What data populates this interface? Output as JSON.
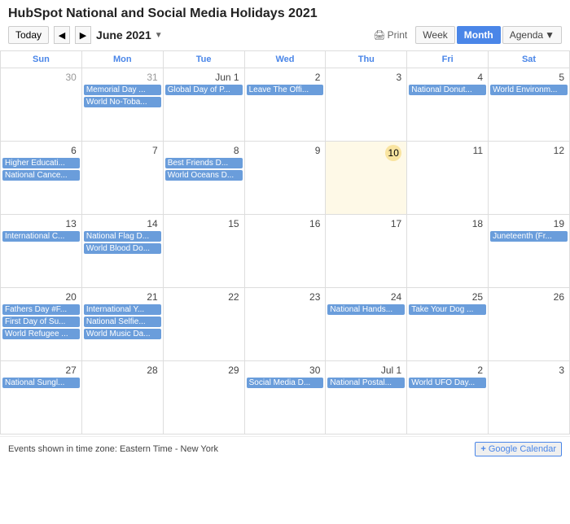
{
  "title": "HubSpot National and Social Media Holidays 2021",
  "toolbar": {
    "today_label": "Today",
    "month_label": "June 2021",
    "print_label": "Print",
    "week_label": "Week",
    "month_btn_label": "Month",
    "agenda_label": "Agenda"
  },
  "day_headers": [
    "Sun",
    "Mon",
    "Tue",
    "Wed",
    "Thu",
    "Fri",
    "Sat"
  ],
  "footer": {
    "timezone_text": "Events shown in time zone: Eastern Time - New York",
    "google_btn": "+ Google Calendar"
  },
  "weeks": [
    {
      "days": [
        {
          "num": "30",
          "other": true,
          "events": []
        },
        {
          "num": "31",
          "other": true,
          "events": [
            {
              "text": "Memorial Day ...",
              "cls": "event-blue"
            },
            {
              "text": "World No-Toba...",
              "cls": "event-blue"
            }
          ]
        },
        {
          "num": "Jun 1",
          "events": [
            {
              "text": "Global Day of P...",
              "cls": "event-blue"
            }
          ]
        },
        {
          "num": "2",
          "events": [
            {
              "text": "Leave The Offi...",
              "cls": "event-blue"
            }
          ]
        },
        {
          "num": "3",
          "events": []
        },
        {
          "num": "4",
          "events": [
            {
              "text": "National Donut...",
              "cls": "event-blue"
            }
          ]
        },
        {
          "num": "5",
          "events": [
            {
              "text": "World Environm...",
              "cls": "event-blue"
            }
          ]
        }
      ]
    },
    {
      "days": [
        {
          "num": "6",
          "events": [
            {
              "text": "Higher Educati...",
              "cls": "event-blue"
            },
            {
              "text": "National Cance...",
              "cls": "event-blue"
            }
          ]
        },
        {
          "num": "7",
          "events": []
        },
        {
          "num": "8",
          "events": [
            {
              "text": "Best Friends D...",
              "cls": "event-blue"
            },
            {
              "text": "World Oceans D...",
              "cls": "event-blue"
            }
          ]
        },
        {
          "num": "9",
          "events": []
        },
        {
          "num": "10",
          "today": true,
          "events": []
        },
        {
          "num": "11",
          "events": []
        },
        {
          "num": "12",
          "events": []
        }
      ]
    },
    {
      "days": [
        {
          "num": "13",
          "events": [
            {
              "text": "International C...",
              "cls": "event-blue"
            }
          ]
        },
        {
          "num": "14",
          "events": [
            {
              "text": "National Flag D...",
              "cls": "event-blue"
            },
            {
              "text": "World Blood Do...",
              "cls": "event-blue"
            }
          ]
        },
        {
          "num": "15",
          "events": []
        },
        {
          "num": "16",
          "events": []
        },
        {
          "num": "17",
          "events": []
        },
        {
          "num": "18",
          "events": []
        },
        {
          "num": "19",
          "events": [
            {
              "text": "Juneteenth (Fr...",
              "cls": "event-blue"
            }
          ]
        }
      ]
    },
    {
      "days": [
        {
          "num": "20",
          "events": [
            {
              "text": "Fathers Day #F...",
              "cls": "event-blue"
            },
            {
              "text": "First Day of Su...",
              "cls": "event-blue"
            },
            {
              "text": "World Refugee ...",
              "cls": "event-blue"
            }
          ]
        },
        {
          "num": "21",
          "events": [
            {
              "text": "International Y...",
              "cls": "event-blue"
            },
            {
              "text": "National Selfie...",
              "cls": "event-blue"
            },
            {
              "text": "World Music Da...",
              "cls": "event-blue"
            }
          ]
        },
        {
          "num": "22",
          "events": []
        },
        {
          "num": "23",
          "events": []
        },
        {
          "num": "24",
          "events": [
            {
              "text": "National Hands...",
              "cls": "event-blue"
            }
          ]
        },
        {
          "num": "25",
          "events": [
            {
              "text": "Take Your Dog ...",
              "cls": "event-blue"
            }
          ]
        },
        {
          "num": "26",
          "events": []
        }
      ]
    },
    {
      "days": [
        {
          "num": "27",
          "events": [
            {
              "text": "National Sungl...",
              "cls": "event-blue"
            }
          ]
        },
        {
          "num": "28",
          "events": []
        },
        {
          "num": "29",
          "events": []
        },
        {
          "num": "30",
          "events": [
            {
              "text": "Social Media D...",
              "cls": "event-blue"
            }
          ]
        },
        {
          "num": "Jul 1",
          "events": [
            {
              "text": "National Postal...",
              "cls": "event-blue"
            }
          ]
        },
        {
          "num": "2",
          "events": [
            {
              "text": "World UFO Day...",
              "cls": "event-blue"
            }
          ]
        },
        {
          "num": "3",
          "events": []
        }
      ]
    }
  ]
}
